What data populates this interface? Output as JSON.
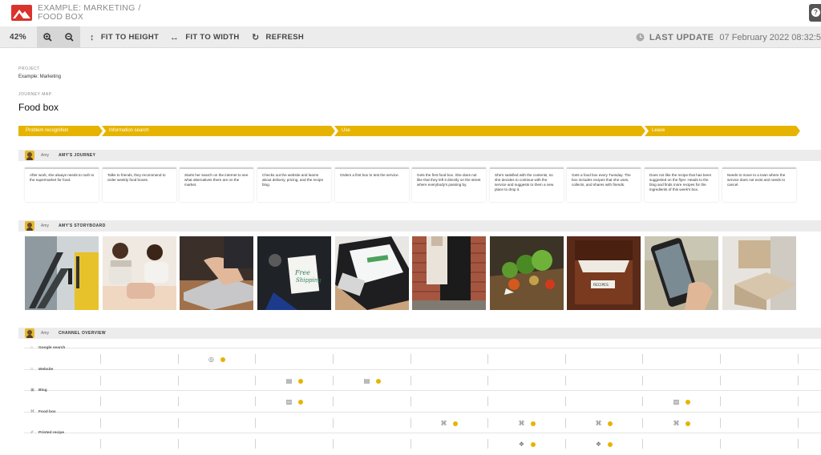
{
  "header": {
    "breadcrumb_1": "EXAMPLE: MARKETING",
    "breadcrumb_sep": "/",
    "breadcrumb_2": "FOOD BOX",
    "help_glyph": "?"
  },
  "toolbar": {
    "zoom": "42%",
    "fit_to_height": "FIT TO HEIGHT",
    "fit_to_width": "FIT TO WIDTH",
    "refresh": "REFRESH",
    "last_update_label": "LAST UPDATE",
    "last_update_value": "07 February 2022 08:32:5"
  },
  "project": {
    "label": "PROJECT",
    "value": "Example: Marketing"
  },
  "journey_map": {
    "label": "JOURNEY MAP",
    "title": "Food box"
  },
  "phases": [
    "Problem recognition",
    "Information search",
    "Use",
    "Leave"
  ],
  "lanes": {
    "journey": {
      "person": "Amy",
      "name": "AMY'S JOURNEY"
    },
    "storyboard": {
      "person": "Amy",
      "name": "AMY'S STORYBOARD"
    },
    "channels": {
      "person": "Amy",
      "name": "CHANNEL OVERVIEW"
    }
  },
  "cards": [
    "After work, she always needs to rush to the supermarket for food.",
    "Talks to friends, they recommend to order weekly food boxes.",
    "Starts her search on the internet to see what alternatives there are on the market.",
    "Checks out the website and learns about delivery, pricing, and the recipe blog.",
    "Orders a first box to test the service.",
    "Gets the first food box. She does not like that they left it directly on the street where everybody's passing by.",
    "She's satisfied with the contents, so she decides to continue with the service and suggests to them a new place to drop it.",
    "Gets a food box every Tuesday. The box includes recipes that she uses, collects, and shares with friends.",
    "Does not like the recipe that has been suggested on the flyer. Heads to the blog and finds more recipes for the ingredients of this week's box.",
    "Needs to move to a town where the service does not exist and needs to cancel."
  ],
  "channels": [
    {
      "name": "Google search",
      "icon": "google-icon",
      "marks": [
        2
      ]
    },
    {
      "name": "Website",
      "icon": "browser-icon",
      "marks": [
        3,
        4
      ]
    },
    {
      "name": "Blog",
      "icon": "blog-icon",
      "marks": [
        3,
        8
      ]
    },
    {
      "name": "Food box",
      "icon": "cart-icon",
      "marks": [
        5,
        6,
        7,
        8
      ]
    },
    {
      "name": "Printed recipe",
      "icon": "tag-icon",
      "marks": [
        6,
        7
      ]
    }
  ],
  "colors": {
    "phase": "#e6b400",
    "logo": "#d9332b",
    "dot": "#e6b400"
  }
}
